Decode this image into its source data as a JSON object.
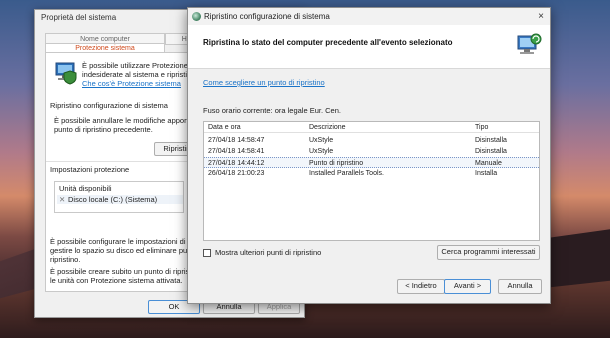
{
  "props_window": {
    "title": "Proprietà del sistema",
    "tabs": [
      "Nome computer",
      "Hardw",
      "Protezione sistema"
    ],
    "intro_text_1": "È possibile utilizzare Protezione siste",
    "intro_text_2": "indesiderate al sistema e ripristinar",
    "what_link": "Che cos'è Protezione sistema",
    "restore_section": "Ripristino configurazione di sistema",
    "restore_desc_1": "È possibile annullare le modifiche apportat",
    "restore_desc_2": "punto di ripristino precedente.",
    "restore_button": "Ripristino",
    "protection_section": "Impostazioni protezione",
    "drives_header": "Unità disponibili",
    "drive_item": "Disco locale (C:) (Sistema)",
    "config_text_1": "È possibile configurare le impostazioni di ri",
    "config_text_2": "gestire lo spazio su disco ed eliminare pun",
    "config_text_3": "ripristino.",
    "create_text_1": "È possibile creare subito un punto di ripristi",
    "create_text_2": "le unità con Protezione sistema attivata.",
    "ok_button": "OK",
    "cancel_button": "Annulla",
    "apply_button": "Applica"
  },
  "wizard": {
    "title": "Ripristino configurazione di sistema",
    "header": "Ripristina lo stato del computer precedente all'evento selezionato",
    "help_link": "Come scegliere un punto di ripristino",
    "timezone": "Fuso orario corrente: ora legale Eur. Cen.",
    "columns": [
      "Data e ora",
      "Descrizione",
      "Tipo"
    ],
    "rows": [
      {
        "date": "27/04/18 14:58:47",
        "desc": "UxStyle",
        "type": "Disinstalla"
      },
      {
        "date": "27/04/18 14:58:41",
        "desc": "UxStyle",
        "type": "Disinstalla"
      },
      {
        "date": "27/04/18 14:44:12",
        "desc": "Punto di ripristino",
        "type": "Manuale"
      },
      {
        "date": "26/04/18 21:00:23",
        "desc": "Installed Parallels Tools.",
        "type": "Installa"
      }
    ],
    "selected_row": 2,
    "show_more": "Mostra ulteriori punti di ripristino",
    "scan_button": "Cerca programmi interessati",
    "back_button": "< Indietro",
    "next_button": "Avanti >",
    "cancel_button": "Annulla",
    "close_glyph": "×"
  }
}
